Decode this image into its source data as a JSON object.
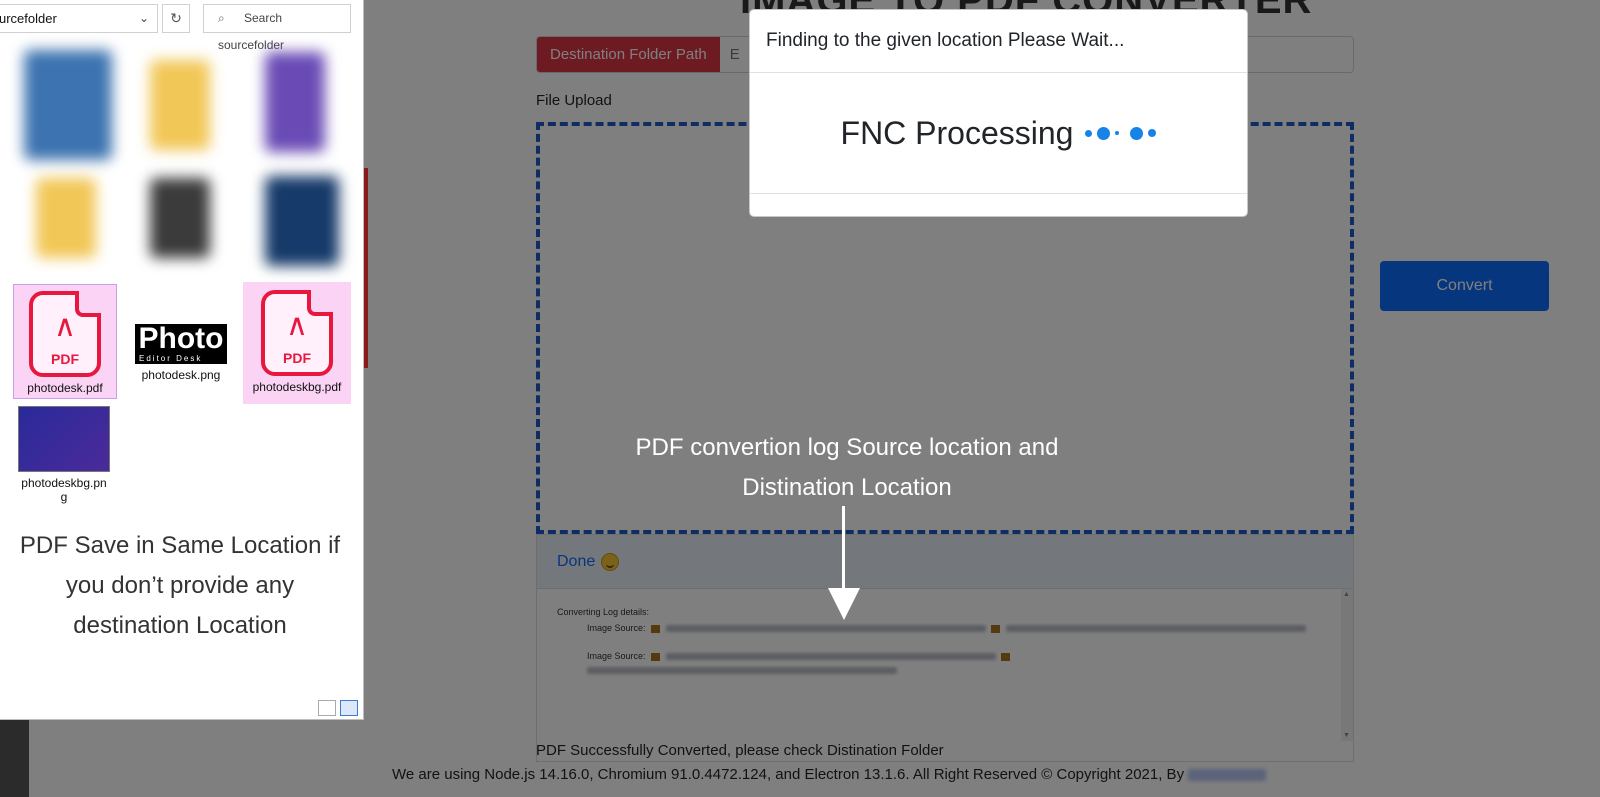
{
  "app": {
    "title": "IMAGE TO PDF CONVERTER",
    "destination_label": "Destination Folder Path",
    "destination_placeholder": "E",
    "file_upload_label": "File Upload",
    "convert_label": "Convert",
    "log": {
      "status": "Done",
      "status_emoji_icon": "smiling-face-icon",
      "header_line": "Converting Log details:",
      "source_label_1": "Image Source:",
      "source_label_2": "Image Source:"
    },
    "success_message": "PDF Successfully Converted, please check Distination Folder",
    "footer_text": "We are using Node.js 14.16.0, Chromium 91.0.4472.124, and Electron 13.1.6. All Right Reserved © Copyright 2021, By"
  },
  "annotation": {
    "log_callout": "PDF convertion log Source location and Distination Location"
  },
  "modal": {
    "title": "Finding to the given location Please Wait...",
    "body": "FNC Processing"
  },
  "explorer": {
    "path": "urcefolder",
    "search_placeholder": "Search sourcefolder",
    "files": [
      {
        "name": "photodesk.pdf",
        "type": "pdf",
        "selected": true
      },
      {
        "name": "photodesk.png",
        "type": "png",
        "selected": false
      },
      {
        "name": "photodeskbg.pdf",
        "type": "pdf",
        "selected": true
      },
      {
        "name": "photodeskbg.pn g",
        "type": "png",
        "selected": false
      }
    ],
    "pdf_icon_text": "PDF",
    "photo_logo_text": "Photo",
    "photo_logo_sub": "Editor Desk",
    "note": "PDF Save in Same Location if you don’t provide any destination Location"
  },
  "colors": {
    "accent_red": "#dc3545",
    "accent_blue": "#0d6efd",
    "dashed_border": "#1e5bc6",
    "pdf_red": "#e8173e",
    "spinner_blue": "#1783e6"
  }
}
